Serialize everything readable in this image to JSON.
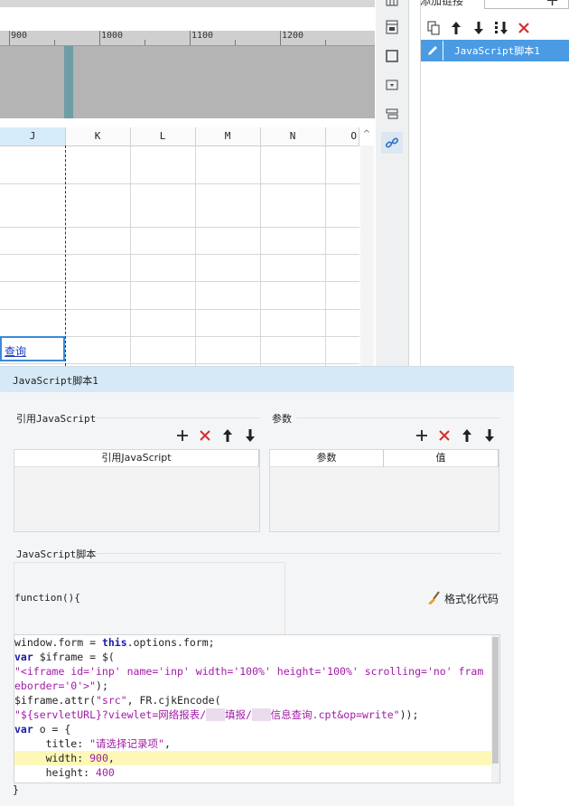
{
  "ruler": {
    "labels": [
      "900",
      "1000",
      "1100",
      "1200"
    ]
  },
  "sheet": {
    "columns": [
      "J",
      "K",
      "L",
      "M",
      "N",
      "O"
    ],
    "selected_column": "J",
    "selected_cell_text": "查询"
  },
  "link_panel": {
    "header_label": "添加链接",
    "add_icon": "+",
    "toolbar": [
      "copy-icon",
      "arrow-up-icon",
      "arrow-down-icon",
      "sort-down-icon",
      "delete-icon"
    ],
    "items": [
      {
        "label": "JavaScript脚本1",
        "icon": "pencil-icon"
      }
    ]
  },
  "dialog": {
    "title": "JavaScript脚本1",
    "ref_js_section": "引用JavaScript",
    "ref_js_column": "引用JavaScript",
    "params_section": "参数",
    "params_columns": [
      "参数",
      "值"
    ],
    "script_section": "JavaScript脚本",
    "function_header": "function(){",
    "format_label": "格式化代码",
    "closing": "}"
  },
  "code_lines": [
    [
      {
        "t": "window.form = ",
        "c": ""
      },
      {
        "t": "this",
        "c": "kw"
      },
      {
        "t": ".options.form;",
        "c": ""
      }
    ],
    [
      {
        "t": "var",
        "c": "kw"
      },
      {
        "t": " $iframe = $(",
        "c": ""
      }
    ],
    [
      {
        "t": "\"<iframe id='inp' name='inp' width='100%' height='100%' scrolling='no' fram",
        "c": "str"
      }
    ],
    [
      {
        "t": "eborder='0'>\"",
        "c": "str"
      },
      {
        "t": ");",
        "c": ""
      }
    ],
    [
      {
        "t": "$iframe.attr(",
        "c": ""
      },
      {
        "t": "\"src\"",
        "c": "str"
      },
      {
        "t": ", FR.cjkEncode(",
        "c": ""
      }
    ],
    [
      {
        "t": "\"${servletURL}?viewlet=网络报表/",
        "c": "str"
      },
      {
        "t": "   ",
        "c": "blur"
      },
      {
        "t": "填报/",
        "c": "str"
      },
      {
        "t": "   ",
        "c": "blur"
      },
      {
        "t": "信息查询.cpt&op=write\"",
        "c": "str"
      },
      {
        "t": "));",
        "c": ""
      }
    ],
    [
      {
        "t": "var",
        "c": "kw"
      },
      {
        "t": " o = {",
        "c": ""
      }
    ],
    [
      {
        "t": "     title: ",
        "c": ""
      },
      {
        "t": "\"请选择记录项\"",
        "c": "str"
      },
      {
        "t": ",",
        "c": ""
      }
    ],
    [
      {
        "t": "     width: ",
        "c": ""
      },
      {
        "t": "900",
        "c": "num"
      },
      {
        "t": ",",
        "c": ""
      }
    ],
    [
      {
        "t": "     height: ",
        "c": ""
      },
      {
        "t": "400",
        "c": "num"
      }
    ]
  ],
  "highlighted_line": 8
}
